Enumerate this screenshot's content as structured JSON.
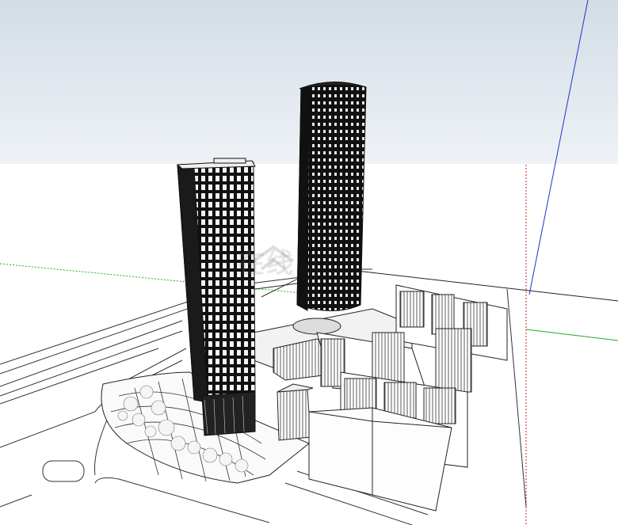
{
  "viewport": {
    "description_label": "3D model view",
    "sky_color_top": "#d3dce6",
    "sky_color_bottom": "#eef2f6",
    "ground_color": "#ffffff"
  },
  "axes": {
    "red_axis_color": "#cc2222",
    "green_axis_color": "#22aa22",
    "blue_axis_color": "#2233cc"
  },
  "watermark": {
    "text": "在线"
  },
  "icons": {
    "model": "building-model-icon"
  }
}
